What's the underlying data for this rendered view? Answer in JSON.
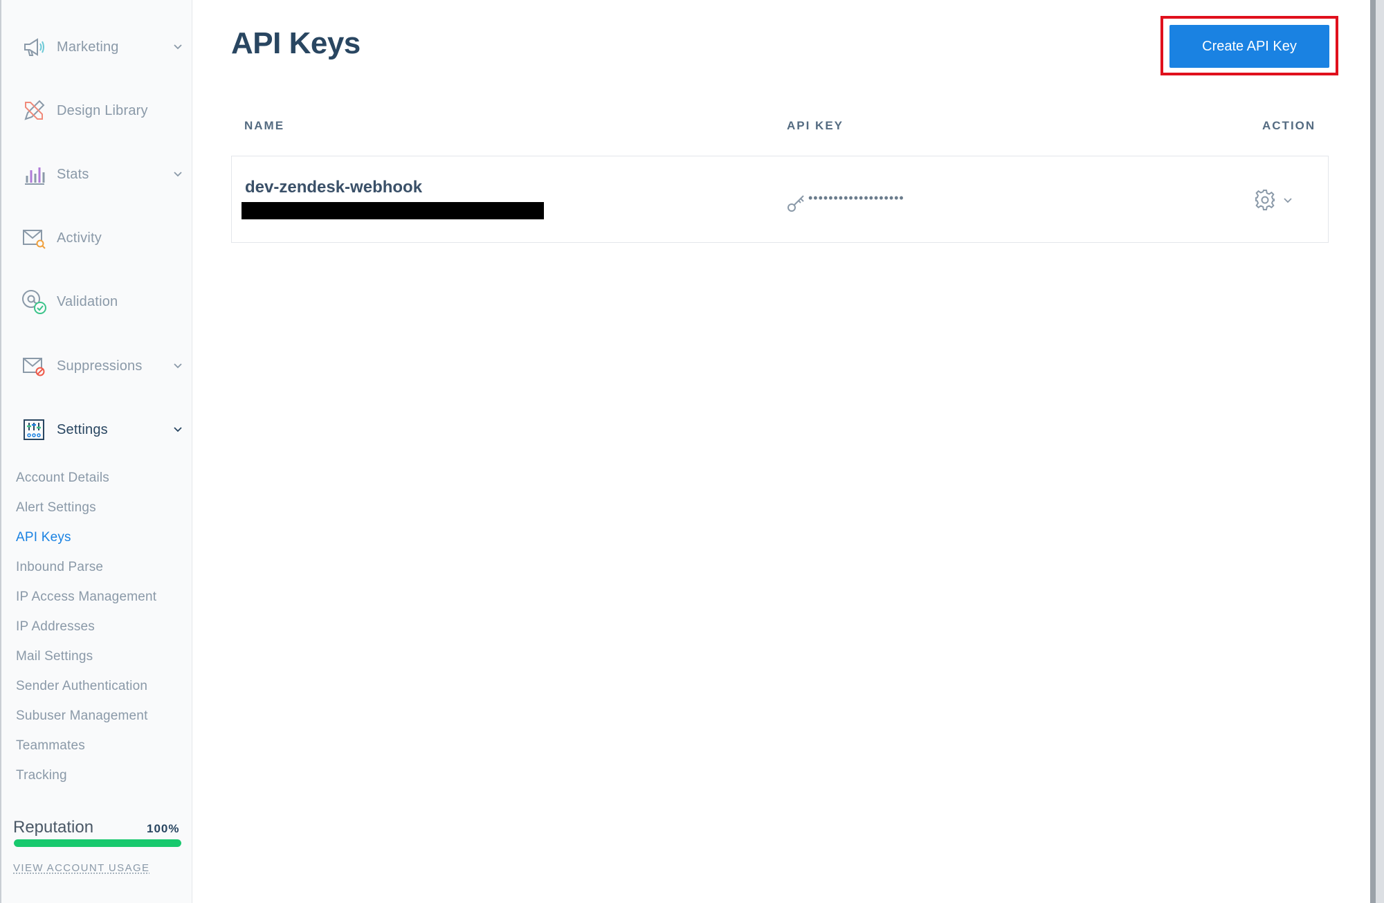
{
  "sidebar": {
    "nav": [
      {
        "label": "Marketing",
        "icon": "megaphone-icon",
        "chevron": true
      },
      {
        "label": "Design Library",
        "icon": "design-tools-icon",
        "chevron": false
      },
      {
        "label": "Stats",
        "icon": "bar-chart-icon",
        "chevron": true
      },
      {
        "label": "Activity",
        "icon": "mail-search-icon",
        "chevron": false
      },
      {
        "label": "Validation",
        "icon": "at-check-icon",
        "chevron": false
      },
      {
        "label": "Suppressions",
        "icon": "mail-blocked-icon",
        "chevron": true
      },
      {
        "label": "Settings",
        "icon": "settings-sliders-icon",
        "chevron": true
      }
    ],
    "settings_items": [
      "Account Details",
      "Alert Settings",
      "API Keys",
      "Inbound Parse",
      "IP Access Management",
      "IP Addresses",
      "Mail Settings",
      "Sender Authentication",
      "Subuser Management",
      "Teammates",
      "Tracking"
    ],
    "active_settings_item": "API Keys",
    "reputation": {
      "label": "Reputation",
      "value": "100%",
      "fill_percent": 100,
      "bar_color": "#18c96e"
    },
    "usage_link": "VIEW ACCOUNT USAGE"
  },
  "main": {
    "title": "API Keys",
    "create_button": "Create API Key",
    "accent_color": "#1a82e2",
    "highlight_color": "#e0101d",
    "columns": {
      "name": "NAME",
      "api_key": "API KEY",
      "action": "ACTION"
    },
    "keys": [
      {
        "name": "dev-zendesk-webhook",
        "masked_key": "•••••••••••••••••••"
      }
    ]
  }
}
